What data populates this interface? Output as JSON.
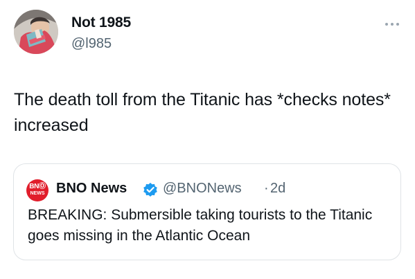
{
  "author": {
    "display_name": "Not 1985",
    "handle": "@l985",
    "avatar_icon": "profile-photo"
  },
  "menu": {
    "icon": "more-horizontal-icon"
  },
  "tweet": {
    "text": "The death toll from the Titanic has *checks notes* increased"
  },
  "quote": {
    "logo_line1": "BNⓄ",
    "logo_line2": "NEWS",
    "logo_color": "#e11d2b",
    "name": "BNO News",
    "verified_color": "#1d9bf0",
    "handle": "@BNONews",
    "separator": "·",
    "time": "2d",
    "text": "BREAKING: Submersible taking tourists to the Titanic goes missing in the Atlantic Ocean"
  }
}
